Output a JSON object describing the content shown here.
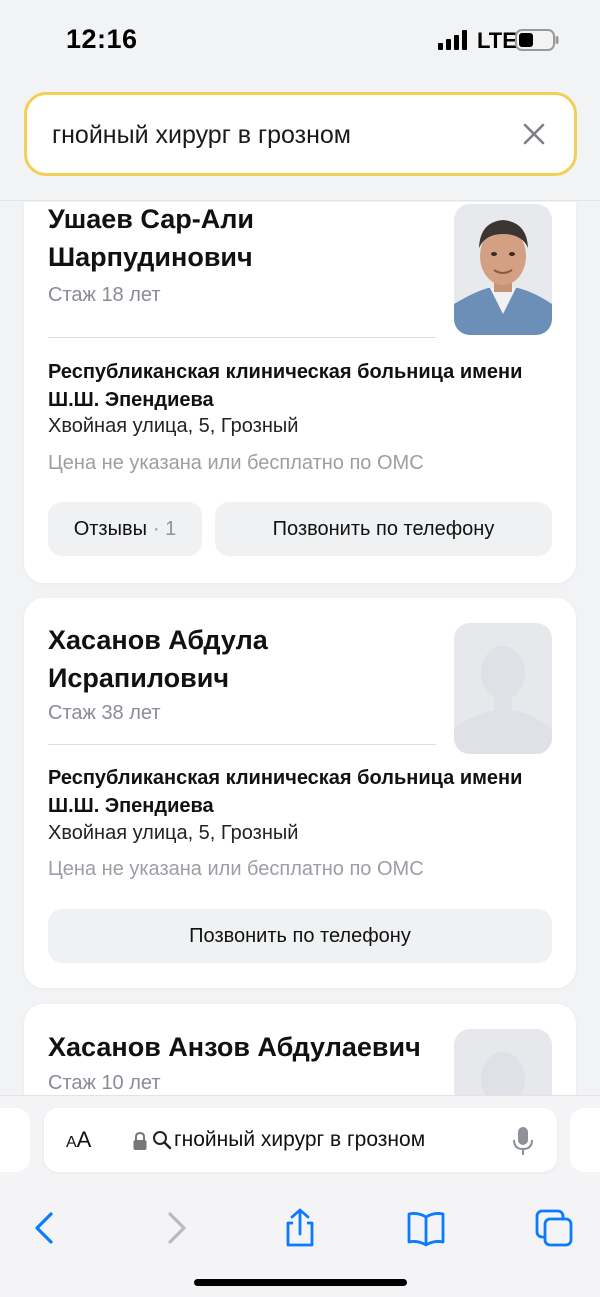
{
  "status_bar": {
    "time": "12:16",
    "network": "LTE"
  },
  "search": {
    "query": "гнойный хирург в грозном"
  },
  "doctors": [
    {
      "name": "Ушаев Сар-Али Шарпудинович",
      "experience": "Стаж 18 лет",
      "clinic": "Республиканская клиническая больница имени Ш.Ш. Эпендиева",
      "address": "Хвойная улица, 5, Грозный",
      "price": "Цена не указана или бесплатно по ОМС",
      "reviews_label": "Отзывы",
      "reviews_count": "· 1",
      "call_label": "Позвонить по телефону",
      "photo": "doctor-photo"
    },
    {
      "name": "Хасанов Абдула Исрапилович",
      "experience": "Стаж 38 лет",
      "clinic": "Республиканская клиническая больница имени Ш.Ш. Эпендиева",
      "address": "Хвойная улица, 5, Грозный",
      "price": "Цена не указана или бесплатно по ОМС",
      "call_label": "Позвонить по телефону",
      "photo": "placeholder-avatar"
    },
    {
      "name": "Хасанов Анзов Абдулаевич",
      "experience": "Стаж 10 лет",
      "photo": "placeholder-avatar"
    }
  ],
  "browser": {
    "text_size_label_small": "A",
    "text_size_label_large": "A",
    "url_text": "гнойный хирург в грозном",
    "icons": [
      "back-icon",
      "forward-icon",
      "share-icon",
      "bookmarks-icon",
      "tabs-icon",
      "lock-icon",
      "search-icon",
      "microphone-icon"
    ]
  },
  "colors": {
    "search_border": "#f3cf55",
    "ios_blue": "#0a7aff",
    "muted_text": "#9b9ea4"
  }
}
